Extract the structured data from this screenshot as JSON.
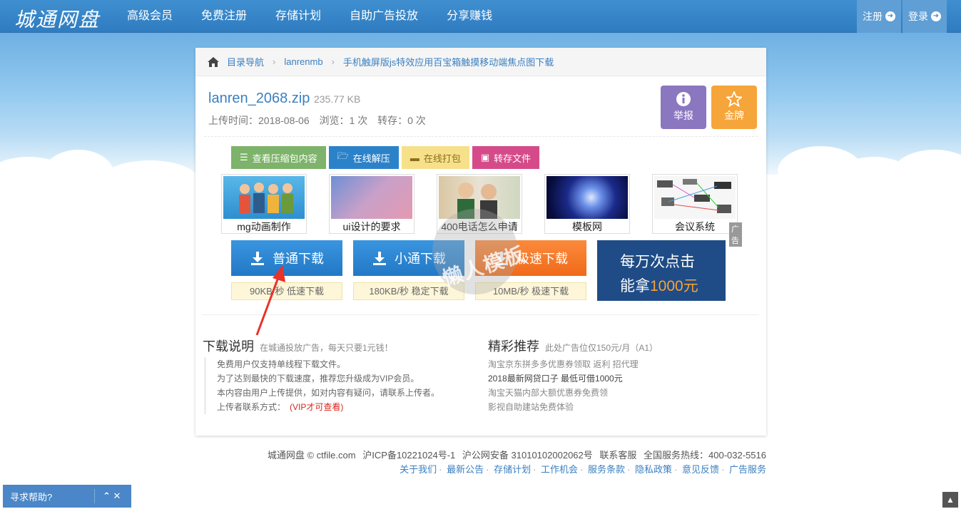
{
  "header": {
    "logo": "城通网盘",
    "nav": [
      "高级会员",
      "免费注册",
      "存储计划",
      "自助广告投放",
      "分享赚钱"
    ],
    "register": "注册",
    "login": "登录"
  },
  "breadcrumb": {
    "items": [
      "目录导航",
      "lanrenmb",
      "手机触屏版js特效应用百宝箱触摸移动端焦点图下载"
    ]
  },
  "file": {
    "name": "lanren_2068.zip",
    "size": "235.77 KB",
    "upload_time": "上传时间：2018-08-06",
    "views": "浏览：1 次",
    "saves": "转存：0 次"
  },
  "actions": {
    "report": "举报",
    "gold": "金牌"
  },
  "tools": [
    "查看压缩包内容",
    "在线解压",
    "在线打包",
    "转存文件"
  ],
  "ads": {
    "items": [
      "mg动画制作",
      "ui设计的要求",
      "400电话怎么申请",
      "模板网",
      "会议系统"
    ],
    "tag": "广告"
  },
  "downloads": [
    {
      "label": "普通下载",
      "note": "90KB/秒 低速下载"
    },
    {
      "label": "小通下载",
      "note": "180KB/秒 稳定下载"
    },
    {
      "label": "极速下载",
      "note": "10MB/秒 极速下载"
    }
  ],
  "promo": {
    "line1": "每万次点击",
    "line2_prefix": "能拿",
    "line2_highlight": "1000元"
  },
  "watermark": "懒人模板",
  "instructions": {
    "title": "下载说明",
    "subtitle": "在城通投放广告，每天只要1元钱！",
    "lines": [
      "免费用户仅支持单线程下载文件。",
      "为了达到最快的下载速度，推荐您升级成为VIP会员。",
      "本内容由用户上传提供，如对内容有疑问，请联系上传者。"
    ],
    "contact_label": "上传者联系方式：",
    "contact_value": "(VIP才可查看)"
  },
  "recommend": {
    "title": "精彩推荐",
    "subtitle": "此处广告位仅150元/月（A1）",
    "items": [
      "淘宝京东拼多多优惠券领取 返利 招代理",
      "2018最新网贷口子 最低可借1000元",
      "淘宝天猫内部大额优惠券免费领",
      "影视自助建站免费体验"
    ]
  },
  "footer": {
    "copyright": "城通网盘 © ctfile.com",
    "icp": "沪ICP备10221024号-1",
    "police": "沪公网安备 31010102002062号",
    "support": "联系客服",
    "hotline": "全国服务热线：400-032-5516",
    "links": [
      "关于我们",
      "最新公告",
      "存储计划",
      "工作机会",
      "服务条款",
      "隐私政策",
      "意见反馈",
      "广告服务"
    ]
  },
  "help": {
    "label": "寻求帮助?"
  },
  "colors": {
    "header": "#3f8fd0",
    "link": "#3a7fc0",
    "download_blue": "#2c82c9",
    "download_orange": "#f07a2a",
    "promo_bg": "#1f4c86"
  }
}
